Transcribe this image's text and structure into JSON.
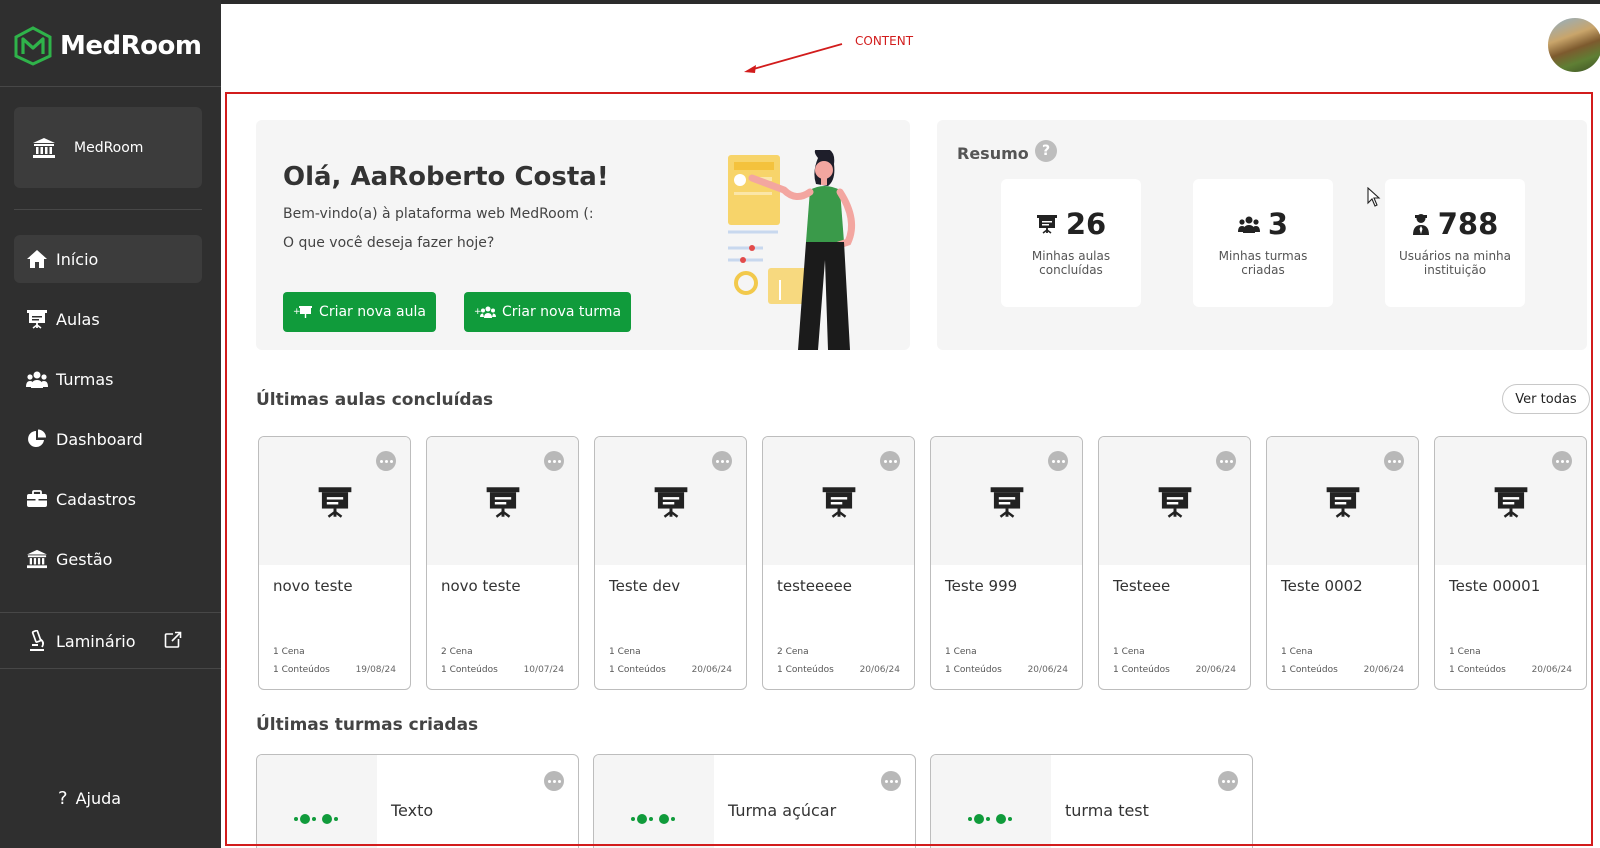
{
  "brand": {
    "name": "MedRoom",
    "accent": "#2fb34a",
    "button_green": "#109b3b",
    "sidebar_bg": "#2f2f2f"
  },
  "sidebar": {
    "institution": {
      "label": "MedRoom",
      "icon": "institution-icon"
    },
    "nav": [
      {
        "label": "Início",
        "icon": "home-icon",
        "active": true
      },
      {
        "label": "Aulas",
        "icon": "presentation-icon"
      },
      {
        "label": "Turmas",
        "icon": "users-icon"
      },
      {
        "label": "Dashboard",
        "icon": "pie-chart-icon"
      },
      {
        "label": "Cadastros",
        "icon": "briefcase-icon"
      },
      {
        "label": "Gestão",
        "icon": "institution-icon"
      }
    ],
    "laminario": {
      "label": "Laminário",
      "icon": "microscope-icon",
      "external_icon": "external-link-icon"
    },
    "help": {
      "label": "Ajuda",
      "icon": "question-icon"
    }
  },
  "annotation": {
    "label": "CONTENT",
    "color": "#d21c1c"
  },
  "welcome": {
    "greeting": "Olá, AaRoberto Costa!",
    "subtitle": "Bem-vindo(a) à plataforma web MedRoom (:",
    "question": "O que você deseja fazer hoje?",
    "create_lesson_label": "Criar nova aula",
    "create_class_label": "Criar nova turma"
  },
  "summary": {
    "title": "Resumo",
    "help_symbol": "?",
    "stats": [
      {
        "value": "26",
        "label": "Minhas aulas concluídas",
        "icon": "presentation-icon"
      },
      {
        "value": "3",
        "label": "Minhas turmas criadas",
        "icon": "users-icon"
      },
      {
        "value": "788",
        "label": "Usuários na minha instituição",
        "icon": "user-tie-icon"
      }
    ]
  },
  "lessons_section": {
    "title": "Últimas aulas concluídas",
    "see_all_label": "Ver todas",
    "cards": [
      {
        "title": "novo teste",
        "scenes": "1 Cena",
        "contents": "1 Conteúdos",
        "date": "19/08/24"
      },
      {
        "title": "novo teste",
        "scenes": "2 Cena",
        "contents": "1 Conteúdos",
        "date": "10/07/24"
      },
      {
        "title": "Teste dev",
        "scenes": "1 Cena",
        "contents": "1 Conteúdos",
        "date": "20/06/24"
      },
      {
        "title": "testeeeee",
        "scenes": "2 Cena",
        "contents": "1 Conteúdos",
        "date": "20/06/24"
      },
      {
        "title": "Teste 999",
        "scenes": "1 Cena",
        "contents": "1 Conteúdos",
        "date": "20/06/24"
      },
      {
        "title": "Testeee",
        "scenes": "1 Cena",
        "contents": "1 Conteúdos",
        "date": "20/06/24"
      },
      {
        "title": "Teste 0002",
        "scenes": "1 Cena",
        "contents": "1 Conteúdos",
        "date": "20/06/24"
      },
      {
        "title": "Teste 00001",
        "scenes": "1 Cena",
        "contents": "1 Conteúdos",
        "date": "20/06/24"
      }
    ]
  },
  "classes_section": {
    "title": "Últimas turmas criadas",
    "cards": [
      {
        "title": "Texto"
      },
      {
        "title": "Turma açúcar"
      },
      {
        "title": "turma test"
      }
    ]
  }
}
